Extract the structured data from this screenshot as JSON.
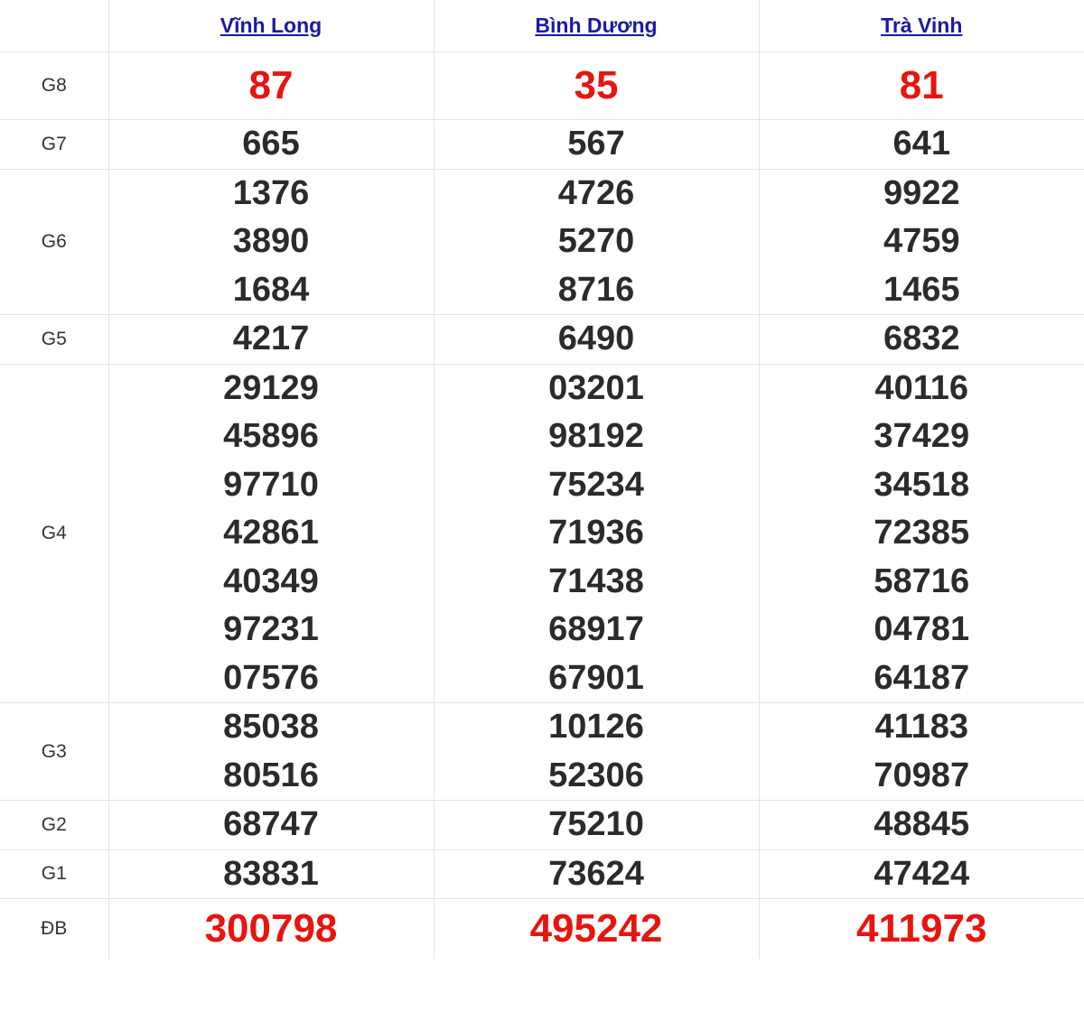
{
  "provinces": [
    {
      "name": "Vĩnh Long"
    },
    {
      "name": "Bình Dương"
    },
    {
      "name": "Trà Vinh"
    }
  ],
  "prizes": [
    {
      "label": "G8",
      "values": [
        [
          "87"
        ],
        [
          "35"
        ],
        [
          "81"
        ]
      ],
      "highlight": true
    },
    {
      "label": "G7",
      "values": [
        [
          "665"
        ],
        [
          "567"
        ],
        [
          "641"
        ]
      ]
    },
    {
      "label": "G6",
      "values": [
        [
          "1376",
          "3890",
          "1684"
        ],
        [
          "4726",
          "5270",
          "8716"
        ],
        [
          "9922",
          "4759",
          "1465"
        ]
      ]
    },
    {
      "label": "G5",
      "values": [
        [
          "4217"
        ],
        [
          "6490"
        ],
        [
          "6832"
        ]
      ]
    },
    {
      "label": "G4",
      "values": [
        [
          "29129",
          "45896",
          "97710",
          "42861",
          "40349",
          "97231",
          "07576"
        ],
        [
          "03201",
          "98192",
          "75234",
          "71936",
          "71438",
          "68917",
          "67901"
        ],
        [
          "40116",
          "37429",
          "34518",
          "72385",
          "58716",
          "04781",
          "64187"
        ]
      ]
    },
    {
      "label": "G3",
      "values": [
        [
          "85038",
          "80516"
        ],
        [
          "10126",
          "52306"
        ],
        [
          "41183",
          "70987"
        ]
      ]
    },
    {
      "label": "G2",
      "values": [
        [
          "68747"
        ],
        [
          "75210"
        ],
        [
          "48845"
        ]
      ]
    },
    {
      "label": "G1",
      "values": [
        [
          "83831"
        ],
        [
          "73624"
        ],
        [
          "47424"
        ]
      ]
    },
    {
      "label": "ĐB",
      "values": [
        [
          "300798"
        ],
        [
          "495242"
        ],
        [
          "411973"
        ]
      ],
      "highlight": true
    }
  ],
  "colors": {
    "highlight": "#e8140f",
    "number": "#2b2b2b",
    "link": "#1a1aa6",
    "border": "#e3e3e3"
  }
}
